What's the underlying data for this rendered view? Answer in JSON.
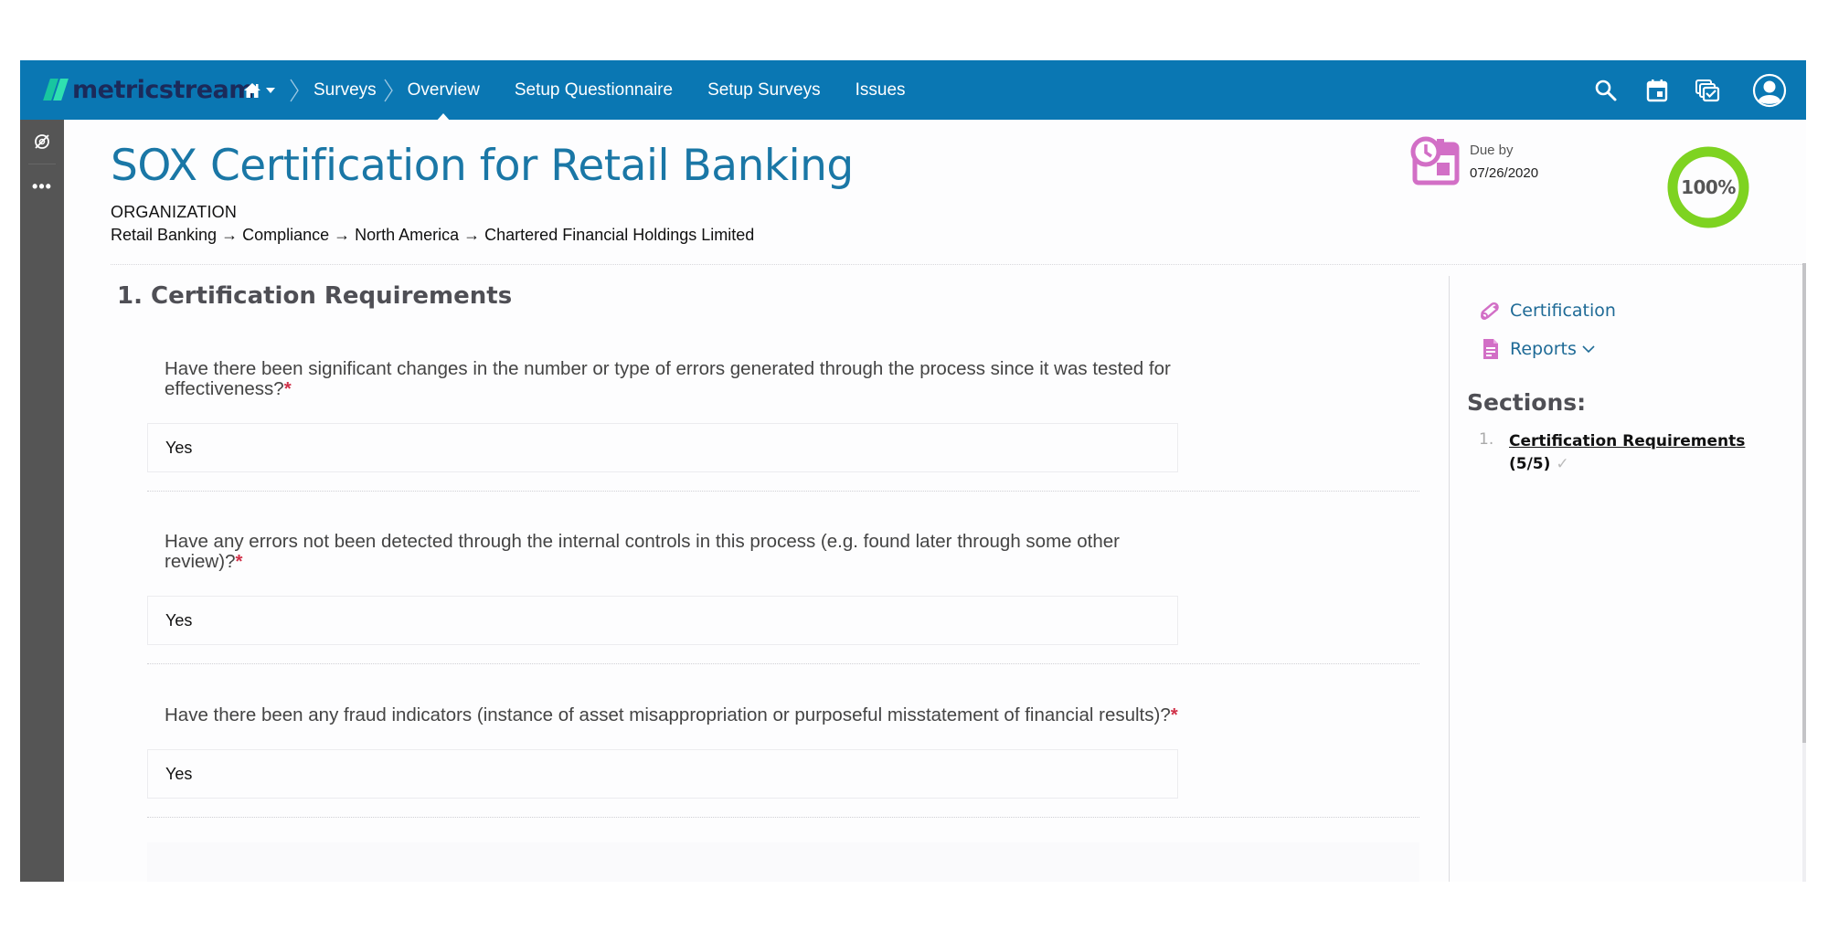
{
  "app": {
    "logo_text": "metricstream",
    "brand_color": "#0a77b3"
  },
  "nav": {
    "home_icon": "home-icon",
    "breadcrumb": [
      "Surveys",
      "Overview"
    ],
    "items": [
      {
        "label": "Setup Questionnaire"
      },
      {
        "label": "Setup Surveys"
      },
      {
        "label": "Issues"
      }
    ],
    "active": "Overview",
    "right_icons": [
      "search-icon",
      "calendar-icon",
      "tasks-icon",
      "user-avatar-icon"
    ]
  },
  "rail": {
    "icons": [
      "compass-icon",
      "more-icon"
    ],
    "more_label": "•••"
  },
  "header": {
    "title": "SOX Certification for Retail Banking",
    "org_label": "ORGANIZATION",
    "org_path": "Retail Banking → Compliance → North America → Chartered Financial Holdings Limited",
    "due_label": "Due by",
    "due_date": "07/26/2020",
    "progress_percent": 100,
    "progress_label": "100%",
    "progress_color": "#7ed321"
  },
  "section": {
    "title": "1. Certification Requirements",
    "questions": [
      {
        "text": "Have there been significant changes in the number or type of errors generated through the process since it was tested for effectiveness?",
        "required_mark": "*",
        "answer": "Yes"
      },
      {
        "text": "Have any errors not been detected through the internal controls in this process (e.g. found later through some other review)?",
        "required_mark": "*",
        "answer": "Yes"
      },
      {
        "text": "Have there been any fraud indicators (instance of asset misappropriation or purposeful misstatement of financial results)?",
        "required_mark": "*",
        "answer": "Yes"
      }
    ]
  },
  "right_panel": {
    "certification_label": "Certification",
    "reports_label": "Reports",
    "sections_title": "Sections:",
    "sections": [
      {
        "number": "1.",
        "label": "Certification Requirements",
        "count": "(5/5)",
        "check": "✓"
      }
    ]
  }
}
